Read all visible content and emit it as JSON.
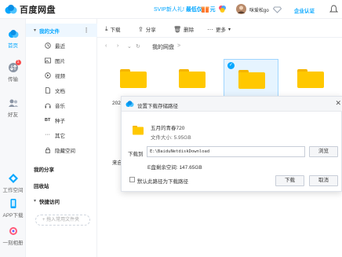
{
  "header": {
    "app_title": "百度网盘",
    "promo_prefix": "SVIP新人礼! ",
    "promo_highlight": "最低仅17 元",
    "username": "咪爱松go",
    "cert_label": "企业认证"
  },
  "rail": {
    "items": [
      {
        "label": "首页",
        "icon": "home-cloud-icon"
      },
      {
        "label": "传输",
        "icon": "transfer-icon",
        "badge": "1"
      },
      {
        "label": "好友",
        "icon": "friends-icon"
      },
      {
        "label": "工作空间",
        "icon": "workspace-icon"
      },
      {
        "label": "APP下载",
        "icon": "phone-icon"
      },
      {
        "label": "一刻相册",
        "icon": "album-icon"
      }
    ]
  },
  "sidebar": {
    "my_files": "我的文件",
    "categories": [
      "最近",
      "图片",
      "视频",
      "文档",
      "音乐",
      "种子",
      "其它",
      "隐藏空间"
    ],
    "my_share": "我的分享",
    "recycle": "回收站",
    "quick_access": "快捷访问",
    "quick_placeholder": "+ 拖入常用文件夹"
  },
  "toolbar": {
    "download": "下载",
    "share": "分享",
    "delete": "删除",
    "more": "更多"
  },
  "breadcrumb": {
    "path": "我的网盘",
    "sep": ">"
  },
  "grid": {
    "partial_left_top": "202",
    "partial_left_bottom": "来自"
  },
  "dialog": {
    "title": "设置下载存储路径",
    "file_name": "五月的青春720",
    "file_size": "文件大小: 5.95GB",
    "path_label": "下载到",
    "path_value": "E:\\BaiduNetdiskDownload",
    "browse": "浏览",
    "free_space": "E盘剩余空间: 147.65GB",
    "default_checkbox": "默认此路径为下载路径",
    "download_btn": "下载",
    "cancel_btn": "取消"
  },
  "colors": {
    "accent": "#06a7ff",
    "folder": "#ffc800",
    "badge": "#fa4b4b"
  }
}
